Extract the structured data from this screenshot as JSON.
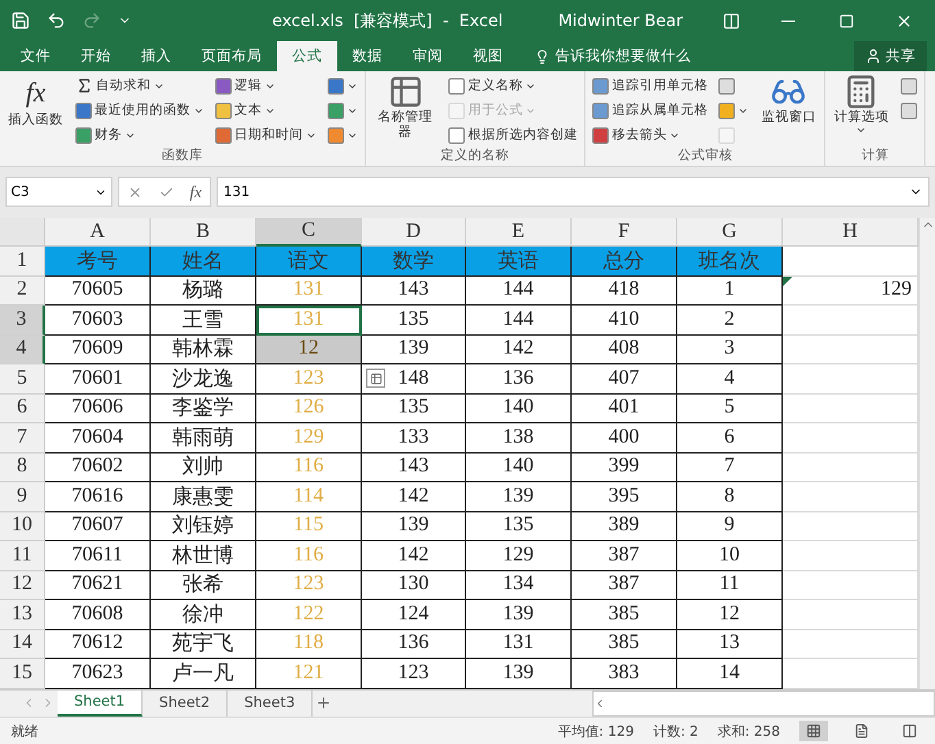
{
  "title_bar": {
    "quick_access": [
      {
        "kind": "save",
        "disabled": false
      },
      {
        "kind": "undo",
        "disabled": false
      },
      {
        "kind": "redo",
        "disabled": true
      },
      {
        "kind": "customize",
        "disabled": false
      }
    ],
    "title": "excel.xls  [兼容模式]  -  Excel",
    "user": "Midwinter Bear",
    "controls": [
      {
        "kind": "ribbon-options"
      },
      {
        "kind": "minimize"
      },
      {
        "kind": "maximize"
      },
      {
        "kind": "close"
      }
    ]
  },
  "tabs": [
    {
      "label": "文件",
      "selected": false
    },
    {
      "label": "开始",
      "selected": false
    },
    {
      "label": "插入",
      "selected": false
    },
    {
      "label": "页面布局",
      "selected": false
    },
    {
      "label": "公式",
      "selected": true
    },
    {
      "label": "数据",
      "selected": false
    },
    {
      "label": "审阅",
      "selected": false
    },
    {
      "label": "视图",
      "selected": false
    }
  ],
  "tell_me": "告诉我你想要做什么",
  "share": "共享",
  "ribbon": [
    {
      "label": "函数库",
      "columns": [
        [
          {
            "kind": "fx",
            "glyph": "fx",
            "label": "插入函数"
          }
        ],
        [
          {
            "kind": "sum",
            "label": "自动求和",
            "dropdown": true,
            "disabled": false
          },
          {
            "kind": "recent",
            "label": "最近使用的函数",
            "dropdown": true,
            "disabled": false
          },
          {
            "kind": "finance",
            "label": "财务",
            "dropdown": true,
            "disabled": false
          }
        ],
        [
          {
            "kind": "logic",
            "label": "逻辑",
            "dropdown": true,
            "disabled": false
          },
          {
            "kind": "text",
            "label": "文本",
            "dropdown": true,
            "disabled": false
          },
          {
            "kind": "date",
            "label": "日期和时间",
            "dropdown": true,
            "disabled": false
          }
        ],
        [
          {
            "kind": "lookup",
            "dropdown": true,
            "disabled": false
          },
          {
            "kind": "math",
            "dropdown": true,
            "disabled": false
          },
          {
            "kind": "more",
            "dropdown": true,
            "disabled": false
          }
        ]
      ]
    },
    {
      "label": "定义的名称",
      "columns": [
        [
          {
            "kind": "name-manager",
            "label": "名称管理器"
          }
        ],
        [
          {
            "kind": "define",
            "label": "定义名称",
            "dropdown": true,
            "disabled": false
          },
          {
            "kind": "use",
            "label": "用于公式",
            "dropdown": true,
            "disabled": true
          },
          {
            "kind": "create",
            "label": "根据所选内容创建",
            "dropdown": false,
            "disabled": false
          }
        ]
      ]
    },
    {
      "label": "公式审核",
      "columns": [
        [
          {
            "kind": "trace",
            "label": "追踪引用单元格",
            "dropdown": false,
            "disabled": false
          },
          {
            "kind": "trace",
            "label": "追踪从属单元格",
            "dropdown": false,
            "disabled": false
          },
          {
            "kind": "remove",
            "label": "移去箭头",
            "dropdown": true,
            "disabled": false
          }
        ],
        [
          {
            "kind": "show",
            "dropdown": false,
            "disabled": false
          },
          {
            "kind": "check",
            "dropdown": true,
            "disabled": false
          },
          {
            "kind": "evaluate",
            "dropdown": false,
            "disabled": true
          }
        ],
        [
          {
            "kind": "watch",
            "label": "监视窗口"
          }
        ]
      ]
    },
    {
      "label": "计算",
      "columns": [
        [
          {
            "kind": "calc",
            "label": "计算选项",
            "dropdown": true
          }
        ],
        [
          {
            "kind": "calc-now",
            "dropdown": false,
            "disabled": false
          },
          {
            "kind": "calc-sheet",
            "dropdown": false,
            "disabled": false
          }
        ]
      ]
    }
  ],
  "formula_bar": {
    "name_box": "C3",
    "glyph": "fx",
    "value": "131"
  },
  "columns": [
    {
      "letter": "A",
      "color": "#222222",
      "selected": false
    },
    {
      "letter": "B",
      "color": "#222222",
      "selected": false
    },
    {
      "letter": "C",
      "color": "#e0ad45",
      "selected": true
    },
    {
      "letter": "D",
      "color": "#222222",
      "selected": false
    },
    {
      "letter": "E",
      "color": "#222222",
      "selected": false
    },
    {
      "letter": "F",
      "color": "#222222",
      "selected": false
    },
    {
      "letter": "G",
      "color": "#222222",
      "selected": false
    },
    {
      "letter": "H",
      "color": "#222222",
      "selected": false
    }
  ],
  "rows": [
    {
      "n": "1",
      "kind": "header",
      "selected": false,
      "active": false,
      "cells": [
        "考号",
        "姓名",
        "语文",
        "数学",
        "英语",
        "总分",
        "班名次"
      ]
    },
    {
      "n": "2",
      "kind": "data",
      "selected": false,
      "active": false,
      "cells": [
        "70605",
        "杨璐",
        "131",
        "143",
        "144",
        "418",
        "1"
      ],
      "h": "129",
      "error_flag": true
    },
    {
      "n": "3",
      "kind": "data",
      "selected": true,
      "active": true,
      "cells": [
        "70603",
        "王雪",
        "131",
        "135",
        "144",
        "410",
        "2"
      ]
    },
    {
      "n": "4",
      "kind": "data",
      "selected": true,
      "active": false,
      "cells": [
        "70609",
        "韩林霖",
        "12",
        "139",
        "142",
        "408",
        "3"
      ]
    },
    {
      "n": "5",
      "kind": "data",
      "selected": false,
      "active": false,
      "cells": [
        "70601",
        "沙龙逸",
        "123",
        "148",
        "136",
        "407",
        "4"
      ],
      "quick_analysis": true
    },
    {
      "n": "6",
      "kind": "data",
      "selected": false,
      "active": false,
      "cells": [
        "70606",
        "李鉴学",
        "126",
        "135",
        "140",
        "401",
        "5"
      ]
    },
    {
      "n": "7",
      "kind": "data",
      "selected": false,
      "active": false,
      "cells": [
        "70604",
        "韩雨萌",
        "129",
        "133",
        "138",
        "400",
        "6"
      ]
    },
    {
      "n": "8",
      "kind": "data",
      "selected": false,
      "active": false,
      "cells": [
        "70602",
        "刘帅",
        "116",
        "143",
        "140",
        "399",
        "7"
      ]
    },
    {
      "n": "9",
      "kind": "data",
      "selected": false,
      "active": false,
      "cells": [
        "70616",
        "康惠雯",
        "114",
        "142",
        "139",
        "395",
        "8"
      ]
    },
    {
      "n": "10",
      "kind": "data",
      "selected": false,
      "active": false,
      "cells": [
        "70607",
        "刘钰婷",
        "115",
        "139",
        "135",
        "389",
        "9"
      ]
    },
    {
      "n": "11",
      "kind": "data",
      "selected": false,
      "active": false,
      "cells": [
        "70611",
        "林世博",
        "116",
        "142",
        "129",
        "387",
        "10"
      ]
    },
    {
      "n": "12",
      "kind": "data",
      "selected": false,
      "active": false,
      "cells": [
        "70621",
        "张希",
        "123",
        "130",
        "134",
        "387",
        "11"
      ]
    },
    {
      "n": "13",
      "kind": "data",
      "selected": false,
      "active": false,
      "cells": [
        "70608",
        "徐冲",
        "122",
        "124",
        "139",
        "385",
        "12"
      ]
    },
    {
      "n": "14",
      "kind": "data",
      "selected": false,
      "active": false,
      "cells": [
        "70612",
        "苑宇飞",
        "118",
        "136",
        "131",
        "385",
        "13"
      ]
    },
    {
      "n": "15",
      "kind": "data",
      "selected": false,
      "active": false,
      "cells": [
        "70623",
        "卢一凡",
        "121",
        "123",
        "139",
        "383",
        "14"
      ]
    }
  ],
  "sheets": [
    {
      "label": "Sheet1",
      "selected": true
    },
    {
      "label": "Sheet2",
      "selected": false
    },
    {
      "label": "Sheet3",
      "selected": false
    }
  ],
  "status_bar": {
    "state": "就绪",
    "stats": [
      "平均值: 129",
      "计数: 2",
      "求和: 258"
    ],
    "views": [
      {
        "kind": "normal",
        "selected": true
      },
      {
        "kind": "page-layout",
        "selected": false
      },
      {
        "kind": "page-break",
        "selected": false
      }
    ]
  }
}
